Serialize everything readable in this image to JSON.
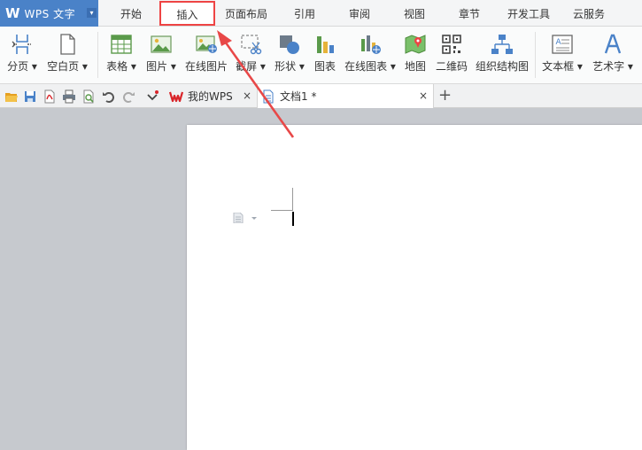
{
  "app": {
    "logo": "W",
    "name": "WPS 文字",
    "dropdown": "▾"
  },
  "menu_tabs": [
    {
      "label": "开始"
    },
    {
      "label": "插入"
    },
    {
      "label": "页面布局"
    },
    {
      "label": "引用"
    },
    {
      "label": "审阅"
    },
    {
      "label": "视图"
    },
    {
      "label": "章节"
    },
    {
      "label": "开发工具"
    },
    {
      "label": "云服务"
    }
  ],
  "ribbon": {
    "page_break": "分页 ▾",
    "blank_page": "空白页 ▾",
    "table": "表格 ▾",
    "picture": "图片 ▾",
    "online_picture": "在线图片",
    "screenshot": "截屏 ▾",
    "shapes": "形状 ▾",
    "chart": "图表",
    "online_chart": "在线图表 ▾",
    "map": "地图",
    "qrcode": "二维码",
    "org_chart": "组织结构图",
    "textbox": "文本框 ▾",
    "wordart": "艺术字 ▾"
  },
  "doc_tabs": [
    {
      "label": "我的WPS",
      "close": "×"
    },
    {
      "label": "文档1 *",
      "close": "×"
    }
  ],
  "new_tab": "+",
  "colors": {
    "accent": "#4a82c8",
    "highlight": "#e44444",
    "wps_red": "#d9252a"
  }
}
